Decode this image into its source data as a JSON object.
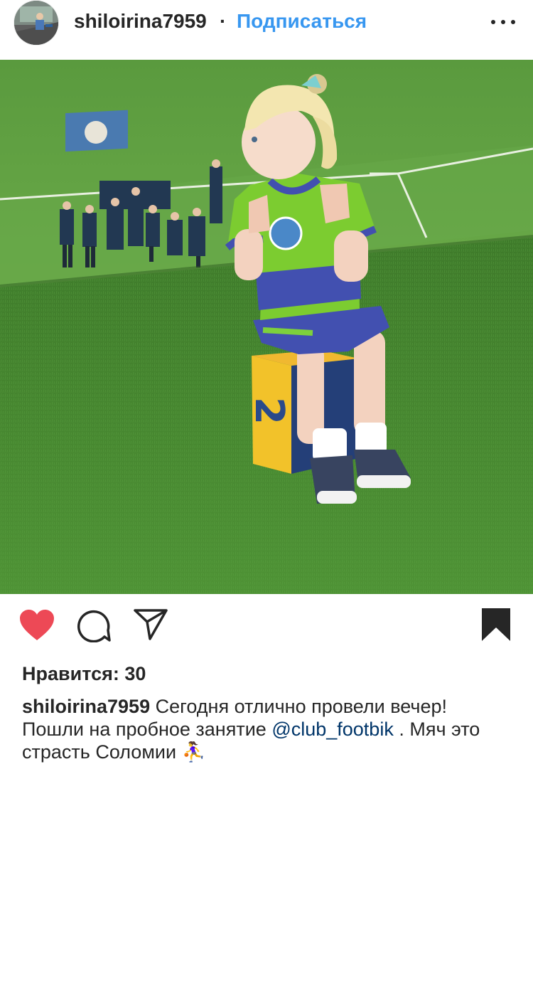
{
  "post": {
    "username": "shiloirina7959",
    "separator": "·",
    "follow_label": "Подписаться",
    "more_icon": "more-horizontal-icon"
  },
  "photo": {
    "jersey_number": "2"
  },
  "actions": {
    "like_icon": "heart-filled-icon",
    "like_color": "#ed4956",
    "comment_icon": "comment-icon",
    "share_icon": "share-icon",
    "save_icon": "bookmark-filled-icon"
  },
  "likes": {
    "text": "Нравится: 30"
  },
  "caption": {
    "username": "shiloirina7959",
    "text_1": " Сегодня отлично провели вечер!",
    "text_2": "Пошли на пробное занятие ",
    "mention": "@club_footbik",
    "text_3": " . Мяч это",
    "text_4": "страсть Соломии ",
    "emoji": "⛹️‍♀️"
  }
}
